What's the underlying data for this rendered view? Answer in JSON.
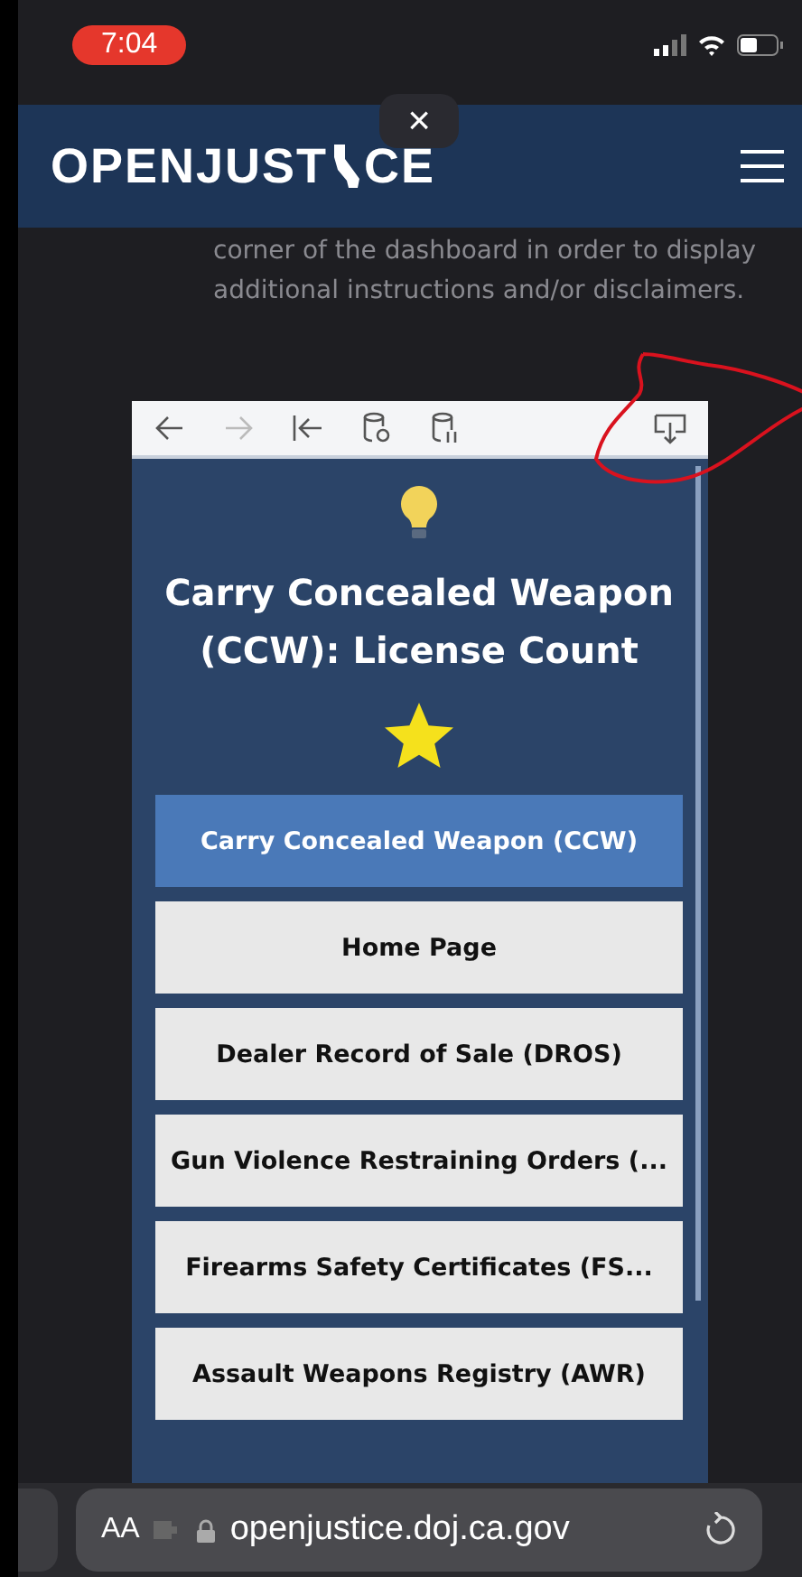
{
  "status_bar": {
    "time": "7:04"
  },
  "header": {
    "logo_before": "OPENJUST",
    "logo_after": "CE",
    "close": "×"
  },
  "intro": "corner of the dashboard in order to display additional instructions and/or disclaimers.",
  "dashboard": {
    "toolbar": [
      {
        "kind": "back",
        "disabled": false
      },
      {
        "kind": "forward",
        "disabled": true
      },
      {
        "kind": "first",
        "disabled": false
      },
      {
        "kind": "refresh",
        "disabled": false
      },
      {
        "kind": "pause",
        "disabled": false
      },
      {
        "kind": "download",
        "disabled": false
      }
    ],
    "title": "Carry Concealed Weapon (CCW): License Count",
    "buttons": [
      {
        "label": "Carry Concealed Weapon (CCW)",
        "selected": true
      },
      {
        "label": "Home Page",
        "selected": false
      },
      {
        "label": "Dealer Record of Sale (DROS)",
        "selected": false
      },
      {
        "label": "Gun Violence Restraining Orders (...",
        "selected": false
      },
      {
        "label": "Firearms Safety Certificates (FS...",
        "selected": false
      },
      {
        "label": "Assault Weapons Registry (AWR)",
        "selected": false
      }
    ]
  },
  "address_bar": {
    "text_size": "AA",
    "url": "openjustice.doj.ca.gov"
  }
}
